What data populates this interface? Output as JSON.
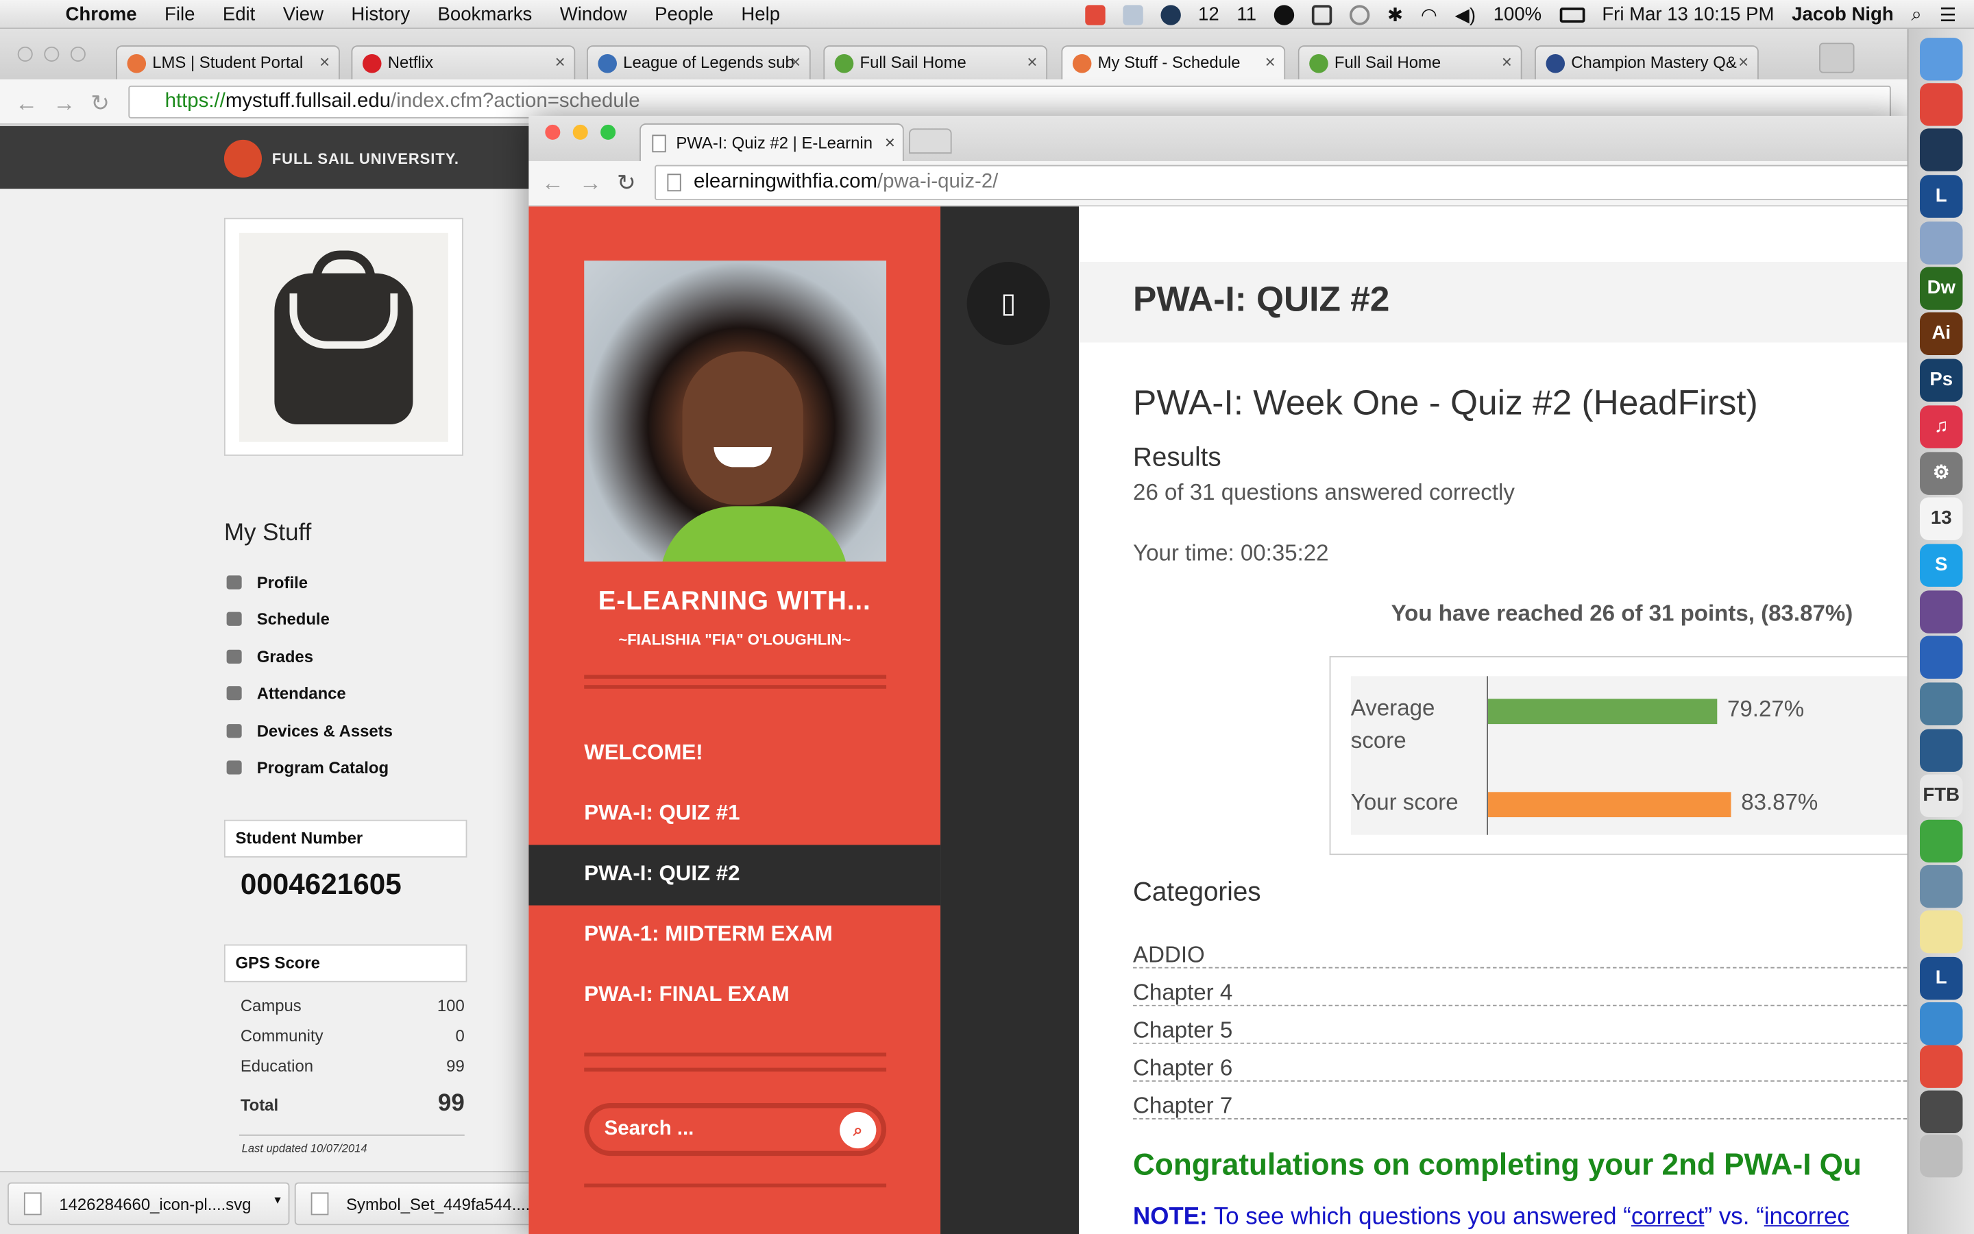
{
  "menubar": {
    "app": "Chrome",
    "items": [
      "File",
      "Edit",
      "View",
      "History",
      "Bookmarks",
      "Window",
      "People",
      "Help"
    ],
    "status": {
      "badge1": "12",
      "badge2": "11",
      "battery": "100%",
      "datetime": "Fri Mar 13  10:15 PM",
      "user": "Jacob Nigh"
    }
  },
  "back_browser": {
    "tabs": [
      {
        "label": "LMS | Student Portal",
        "color": "#e8743b"
      },
      {
        "label": "Netflix",
        "color": "#d81f26"
      },
      {
        "label": "League of Legends sub",
        "color": "#3a6fb7"
      },
      {
        "label": "Full Sail Home",
        "color": "#5aa43a"
      },
      {
        "label": "My Stuff - Schedule",
        "color": "#e8743b"
      },
      {
        "label": "Full Sail Home",
        "color": "#5aa43a"
      },
      {
        "label": "Champion Mastery Q&",
        "color": "#2a4a8a"
      }
    ],
    "url": {
      "scheme": "https://",
      "host": "mystuff.fullsail.edu",
      "path": "/index.cfm?action=schedule"
    },
    "logo_text": "FULL SAIL UNIVERSITY.",
    "sidebar_title": "My Stuff",
    "sidebar_items": [
      "Profile",
      "Schedule",
      "Grades",
      "Attendance",
      "Devices & Assets",
      "Program Catalog"
    ],
    "student_number_label": "Student Number",
    "student_number": "0004621605",
    "gps_label": "GPS Score",
    "gps_rows": [
      {
        "label": "Campus",
        "value": "100"
      },
      {
        "label": "Community",
        "value": "0"
      },
      {
        "label": "Education",
        "value": "99"
      }
    ],
    "gps_total_label": "Total",
    "gps_total": "99",
    "last_updated": "Last updated 10/07/2014",
    "downloads": [
      "1426284660_icon-pl....svg",
      "Symbol_Set_449fa544....z"
    ]
  },
  "front_browser": {
    "tab_label": "PWA-I: Quiz #2 | E-Learnin",
    "url": {
      "host": "elearningwithfia.com",
      "path": "/pwa-i-quiz-2/"
    },
    "site_title": "E-LEARNING WITH...",
    "site_subtitle": "~FIALISHIA \"FIA\" O'LOUGHLIN~",
    "nav": [
      "WELCOME!",
      "PWA-I: QUIZ #1",
      "PWA-I: QUIZ #2",
      "PWA-1: MIDTERM EXAM",
      "PWA-I: FINAL EXAM"
    ],
    "active_nav_index": 2,
    "search_placeholder": "Search ...",
    "page_title": "PWA-I: QUIZ #2",
    "quiz_title": "PWA-I: Week One - Quiz #2 (HeadFirst)",
    "results_heading": "Results",
    "answered_text": "26 of 31 questions answered correctly",
    "time_text": "Your time: 00:35:22",
    "reached_text": "You have reached 26 of 31 points, (83.87%)",
    "scores": [
      {
        "label_line1": "Average",
        "label_line2": "score",
        "value": 79.27,
        "value_text": "79.27%",
        "color": "#6aa84f"
      },
      {
        "label_line1": "Your score",
        "label_line2": "",
        "value": 83.87,
        "value_text": "83.87%",
        "color": "#f6923d"
      }
    ],
    "categories_heading": "Categories",
    "categories": [
      "ADDIO",
      "Chapter 4",
      "Chapter 5",
      "Chapter 6",
      "Chapter 7"
    ],
    "congrats": "Congratulations on completing your 2nd PWA-I Qu",
    "note_label": "NOTE:",
    "note_text": " To see which questions you answered “",
    "note_link1": "correct",
    "note_mid": "” vs. “",
    "note_link2": "incorrec"
  },
  "dock": [
    {
      "name": "finder-icon",
      "color": "#5b9be0",
      "glyph": ""
    },
    {
      "name": "chrome-icon",
      "color": "#e0463a",
      "glyph": ""
    },
    {
      "name": "steam-icon",
      "color": "#1e3756",
      "glyph": ""
    },
    {
      "name": "league-icon",
      "color": "#1b4d8e",
      "glyph": "L"
    },
    {
      "name": "mail-icon",
      "color": "#8aa4c8",
      "glyph": ""
    },
    {
      "name": "dreamweaver-icon",
      "color": "#2b6b1f",
      "glyph": "Dw"
    },
    {
      "name": "illustrator-icon",
      "color": "#6a3411",
      "glyph": "Ai"
    },
    {
      "name": "photoshop-icon",
      "color": "#173f68",
      "glyph": "Ps"
    },
    {
      "name": "itunes-icon",
      "color": "#e0344b",
      "glyph": "♫"
    },
    {
      "name": "settings-icon",
      "color": "#7a7a7a",
      "glyph": "⚙"
    },
    {
      "name": "calendar-icon",
      "color": "#f4f4f4",
      "glyph": "13"
    },
    {
      "name": "skype-icon",
      "color": "#1da1e8",
      "glyph": "S"
    },
    {
      "name": "github-icon",
      "color": "#6a4a8f",
      "glyph": ""
    },
    {
      "name": "filezilla-icon",
      "color": "#2a62b8",
      "glyph": ""
    },
    {
      "name": "preview-icon",
      "color": "#4c7a9a",
      "glyph": ""
    },
    {
      "name": "bridge-icon",
      "color": "#2a5a8a",
      "glyph": ""
    },
    {
      "name": "ftb-icon",
      "color": "#e8e8e8",
      "glyph": "FTB"
    },
    {
      "name": "spotify-icon",
      "color": "#3fa63f",
      "glyph": ""
    },
    {
      "name": "teamspeak-icon",
      "color": "#6a8ca8",
      "glyph": ""
    },
    {
      "name": "notes-icon",
      "color": "#f1e39a",
      "glyph": ""
    },
    {
      "name": "league-icon-2",
      "color": "#1b4d8e",
      "glyph": "L"
    },
    {
      "name": "blender-icon",
      "color": "#3a8ad0",
      "glyph": ""
    },
    {
      "name": "sketch-icon",
      "color": "#e24a3a",
      "glyph": ""
    },
    {
      "name": "downloads-icon",
      "color": "#4a4a4a",
      "glyph": ""
    },
    {
      "name": "trash-icon",
      "color": "#bdbdbd",
      "glyph": ""
    }
  ]
}
